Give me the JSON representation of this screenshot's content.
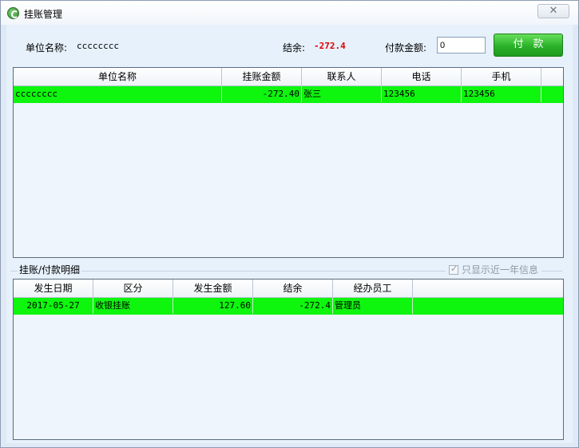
{
  "window": {
    "title": "挂账管理",
    "close_glyph": "✕"
  },
  "header": {
    "unit_label": "单位名称:",
    "unit_value": "cccccccc",
    "balance_label": "结余:",
    "balance_value": "-272.4",
    "pay_amount_label": "付款金额:",
    "pay_amount_value": "0",
    "pay_button": "付款"
  },
  "top_table": {
    "columns": [
      "单位名称",
      "挂账金额",
      "联系人",
      "电话",
      "手机"
    ],
    "rows": [
      {
        "unit": "cccccccc",
        "amount": "-272.40",
        "contact": "张三",
        "phone": "123456",
        "mobile": "123456"
      }
    ]
  },
  "detail": {
    "title": "挂账/付款明细",
    "only_recent_year_label": "只显示近一年信息",
    "only_recent_year_checked": true
  },
  "bottom_table": {
    "columns": [
      "发生日期",
      "区分",
      "发生金额",
      "结余",
      "经办员工"
    ],
    "rows": [
      {
        "date": "2017-05-27",
        "type": "收银挂账",
        "amount": "127.60",
        "balance": "-272.4",
        "operator": "管理员"
      }
    ]
  },
  "colors": {
    "row_highlight": "#0ef50e",
    "accent_red": "#e00000",
    "button_green": "#2ab22a"
  }
}
